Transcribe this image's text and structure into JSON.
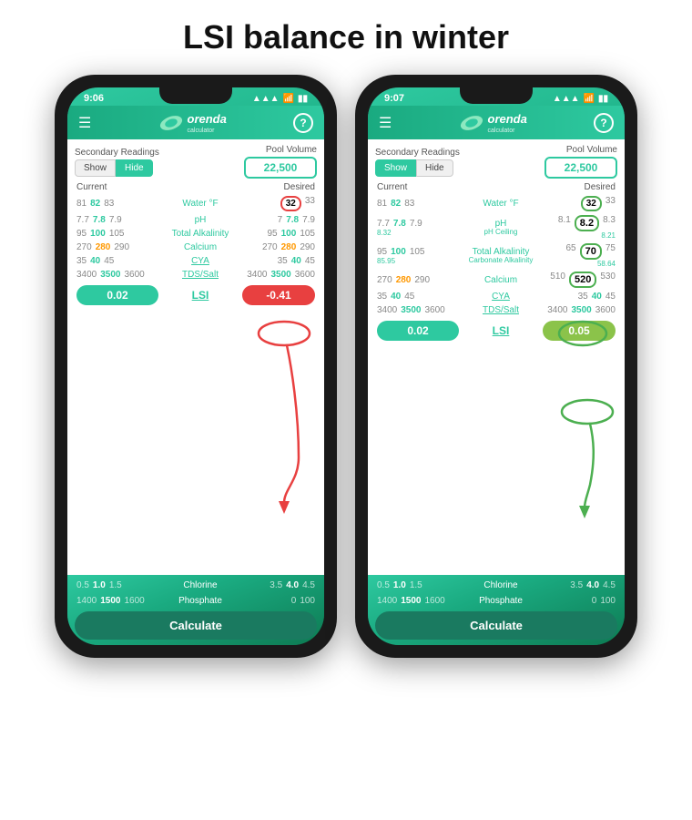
{
  "page": {
    "title": "LSI balance in winter"
  },
  "phone1": {
    "status_time": "9:06",
    "secondary_readings": "Secondary Readings",
    "pool_volume_label": "Pool Volume",
    "show_label": "Show",
    "hide_label": "Hide",
    "pool_volume": "22,500",
    "current_label": "Current",
    "desired_label": "Desired",
    "water_label": "Water °F",
    "ph_label": "pH",
    "alkalinity_label": "Total Alkalinity",
    "calcium_label": "Calcium",
    "cya_label": "CYA",
    "tds_label": "TDS/Salt",
    "lsi_label": "LSI",
    "chlorine_label": "Chlorine",
    "phosphate_label": "Phosphate",
    "calculate_label": "Calculate",
    "lsi_current": "0.02",
    "lsi_desired": "-0.41",
    "rows": {
      "water": {
        "c1": "81",
        "c2": "82",
        "c3": "83",
        "d1": "32",
        "d2": "33"
      },
      "ph": {
        "c1": "7.7",
        "c2": "7.8",
        "c3": "7.9",
        "d1": "7",
        "d2": "7.8",
        "d3": "7.9"
      },
      "alkalinity": {
        "c1": "95",
        "c2": "100",
        "c3": "105",
        "d1": "95",
        "d2": "100",
        "d3": "105"
      },
      "calcium": {
        "c1": "270",
        "c2": "280",
        "c3": "290",
        "d1": "270",
        "d2": "280",
        "d3": "290"
      },
      "cya": {
        "c1": "35",
        "c2": "40",
        "c3": "45",
        "d1": "35",
        "d2": "40",
        "d3": "45"
      },
      "tds": {
        "c1": "3400",
        "c2": "3500",
        "c3": "3600",
        "d1": "3400",
        "d2": "3500",
        "d3": "3600"
      },
      "chlorine": {
        "c1": "0.5",
        "c2": "1.0",
        "c3": "1.5",
        "d1": "3.5",
        "d2": "4.0",
        "d3": "4.5"
      },
      "phosphate": {
        "c1": "1400",
        "c2": "1500",
        "c3": "1600",
        "d1": "0",
        "d3": "100"
      }
    }
  },
  "phone2": {
    "status_time": "9:07",
    "secondary_readings": "Secondary Readings",
    "pool_volume_label": "Pool Volume",
    "show_label": "Show",
    "hide_label": "Hide",
    "pool_volume": "22,500",
    "current_label": "Current",
    "desired_label": "Desired",
    "water_label": "Water °F",
    "ph_label": "pH",
    "ph_ceiling_label": "pH Ceiling",
    "alkalinity_label": "Total Alkalinity",
    "carbonate_label": "Carbonate Alkalinity",
    "calcium_label": "Calcium",
    "cya_label": "CYA",
    "tds_label": "TDS/Salt",
    "lsi_label": "LSI",
    "chlorine_label": "Chlorine",
    "phosphate_label": "Phosphate",
    "calculate_label": "Calculate",
    "lsi_current": "0.02",
    "lsi_desired": "0.05",
    "rows": {
      "water": {
        "c1": "81",
        "c2": "82",
        "c3": "83",
        "d1": "32",
        "d2": "33"
      },
      "ph": {
        "c1": "7.7",
        "c2": "7.8",
        "c3": "7.9",
        "sub1": "8.32",
        "d1": "8.1",
        "d2": "8.2",
        "d3": "8.3",
        "sub2": "8.21"
      },
      "alkalinity": {
        "c1": "95",
        "c2": "100",
        "c3": "105",
        "sub1": "85.95",
        "d1": "65",
        "d2": "70",
        "d3": "75",
        "sub2": "58.64"
      },
      "calcium": {
        "c1": "270",
        "c2": "280",
        "c3": "290",
        "d1": "510",
        "d2": "520",
        "d3": "530"
      },
      "cya": {
        "c1": "35",
        "c2": "40",
        "c3": "45",
        "d1": "35",
        "d2": "40",
        "d3": "45"
      },
      "tds": {
        "c1": "3400",
        "c2": "3500",
        "c3": "3600",
        "d1": "3400",
        "d2": "3500",
        "d3": "3600"
      },
      "chlorine": {
        "c1": "0.5",
        "c2": "1.0",
        "c3": "1.5",
        "d1": "3.5",
        "d2": "4.0",
        "d3": "4.5"
      },
      "phosphate": {
        "c1": "1400",
        "c2": "1500",
        "c3": "1600",
        "d1": "0",
        "d3": "100"
      }
    }
  }
}
